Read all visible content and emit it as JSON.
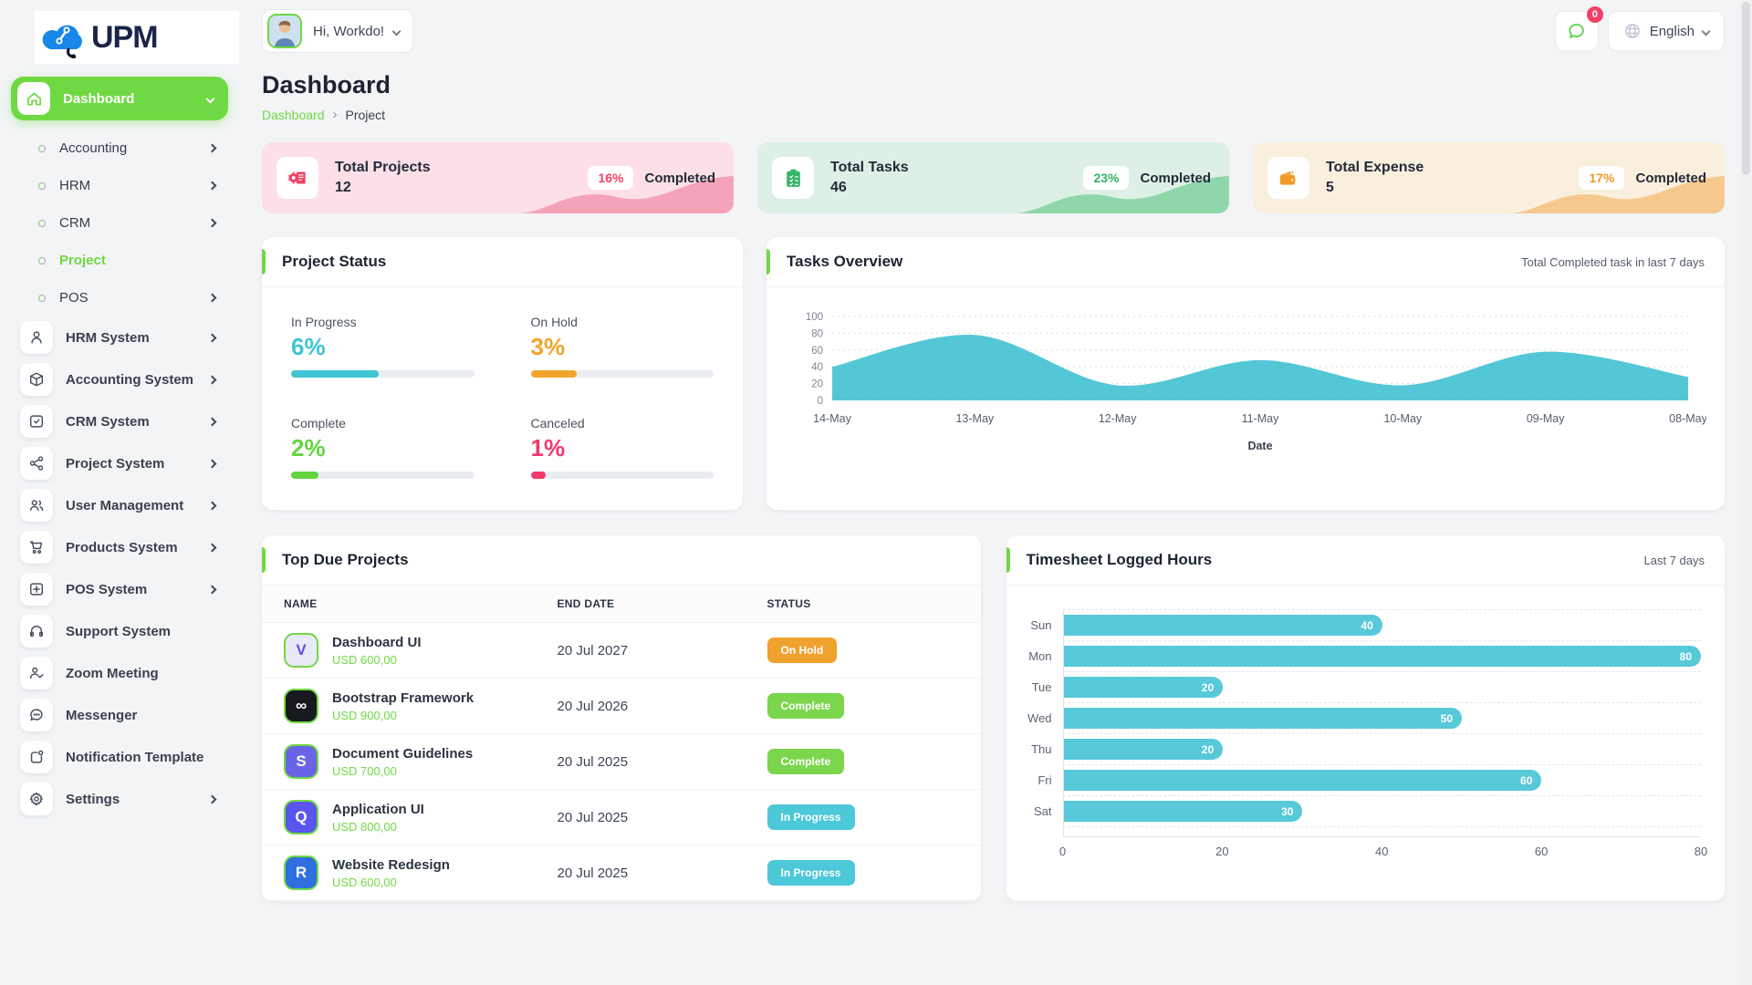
{
  "app": {
    "logo_text": "UPM"
  },
  "header": {
    "greeting": "Hi, Workdo!",
    "notification_count": "0",
    "language": "English"
  },
  "sidebar": {
    "dashboard": {
      "label": "Dashboard"
    },
    "sub_items": [
      {
        "label": "Accounting"
      },
      {
        "label": "HRM"
      },
      {
        "label": "CRM"
      },
      {
        "label": "Project"
      },
      {
        "label": "POS"
      }
    ],
    "system_items": [
      {
        "label": "HRM System"
      },
      {
        "label": "Accounting System"
      },
      {
        "label": "CRM System"
      },
      {
        "label": "Project System"
      },
      {
        "label": "User Management"
      },
      {
        "label": "Products System"
      },
      {
        "label": "POS System"
      },
      {
        "label": "Support System"
      },
      {
        "label": "Zoom Meeting"
      },
      {
        "label": "Messenger"
      },
      {
        "label": "Notification Template"
      },
      {
        "label": "Settings"
      }
    ]
  },
  "page": {
    "title": "Dashboard",
    "breadcrumb_root": "Dashboard",
    "breadcrumb_current": "Project"
  },
  "stats": [
    {
      "title": "Total Projects",
      "value": "12",
      "percent": "16%",
      "completed_label": "Completed",
      "bg": "#fcdfe7",
      "wave": "#f4a3b8",
      "accent": "#f43f64"
    },
    {
      "title": "Total Tasks",
      "value": "46",
      "percent": "23%",
      "completed_label": "Completed",
      "bg": "#def0e6",
      "wave": "#8fd7ab",
      "accent": "#35b469"
    },
    {
      "title": "Total Expense",
      "value": "5",
      "percent": "17%",
      "completed_label": "Completed",
      "bg": "#faefdd",
      "wave": "#f6c88e",
      "accent": "#f09a28"
    }
  ],
  "project_status": {
    "title": "Project Status",
    "metrics": [
      {
        "label": "In Progress",
        "value": "6%",
        "bar_percent": 48,
        "color": "#3fc4d4"
      },
      {
        "label": "On Hold",
        "value": "3%",
        "bar_percent": 25,
        "color": "#f2a42c"
      },
      {
        "label": "Complete",
        "value": "2%",
        "bar_percent": 15,
        "color": "#62d53f"
      },
      {
        "label": "Canceled",
        "value": "1%",
        "bar_percent": 8,
        "color": "#f2396b"
      }
    ]
  },
  "chart_data": [
    {
      "type": "area",
      "title": "Tasks Overview",
      "subtitle": "Total Completed task in last 7 days",
      "x": [
        "14-May",
        "13-May",
        "12-May",
        "11-May",
        "10-May",
        "09-May",
        "08-May"
      ],
      "values": [
        40,
        78,
        18,
        48,
        18,
        58,
        28
      ],
      "xlabel": "Date",
      "ylim": [
        0,
        100
      ],
      "yticks": [
        0,
        20,
        40,
        60,
        80,
        100
      ],
      "color": "#53c7d6",
      "grid": "dashed-horizontal",
      "legend": "none"
    },
    {
      "type": "bar",
      "orientation": "horizontal",
      "title": "Timesheet Logged Hours",
      "subtitle": "Last 7 days",
      "categories": [
        "Sun",
        "Mon",
        "Tue",
        "Wed",
        "Thu",
        "Fri",
        "Sat"
      ],
      "values": [
        40,
        80,
        20,
        50,
        20,
        60,
        30
      ],
      "xlim": [
        0,
        80
      ],
      "xticks": [
        0,
        20,
        40,
        60,
        80
      ],
      "color": "#57c9d8",
      "grid": "dashed-horizontal",
      "legend": "none"
    }
  ],
  "top_due_projects": {
    "title": "Top Due Projects",
    "columns": [
      "NAME",
      "END DATE",
      "STATUS"
    ],
    "rows": [
      {
        "name": "Dashboard UI",
        "amount": "USD 600,00",
        "end_date": "20 Jul 2027",
        "status": "On Hold",
        "status_color": "#f0a22e",
        "icon": {
          "glyph": "V",
          "bg": "#e9e9f8",
          "fg": "#6050e8"
        }
      },
      {
        "name": "Bootstrap Framework",
        "amount": "USD 900,00",
        "end_date": "20 Jul 2026",
        "status": "Complete",
        "status_color": "#7bd64d",
        "icon": {
          "glyph": "∞",
          "bg": "#17191e",
          "fg": "#ffffff"
        }
      },
      {
        "name": "Document Guidelines",
        "amount": "USD 700,00",
        "end_date": "20 Jul 2025",
        "status": "Complete",
        "status_color": "#7bd64d",
        "icon": {
          "glyph": "S",
          "bg": "#6a63e8",
          "fg": "#ffffff"
        }
      },
      {
        "name": "Application UI",
        "amount": "USD 800,00",
        "end_date": "20 Jul 2025",
        "status": "In Progress",
        "status_color": "#4cc8d9",
        "icon": {
          "glyph": "Q",
          "bg": "#5a55ee",
          "fg": "#ffffff"
        }
      },
      {
        "name": "Website Redesign",
        "amount": "USD 600,00",
        "end_date": "20 Jul 2025",
        "status": "In Progress",
        "status_color": "#4cc8d9",
        "icon": {
          "glyph": "R",
          "bg": "#2f6fe0",
          "fg": "#ffffff"
        }
      }
    ]
  },
  "colors": {
    "accent_green": "#6fd943",
    "teal": "#53c7d6",
    "orange": "#f0a22e",
    "pink": "#f43f64",
    "complete_green": "#7bd64d",
    "page_bg": "#f2f4f6"
  }
}
